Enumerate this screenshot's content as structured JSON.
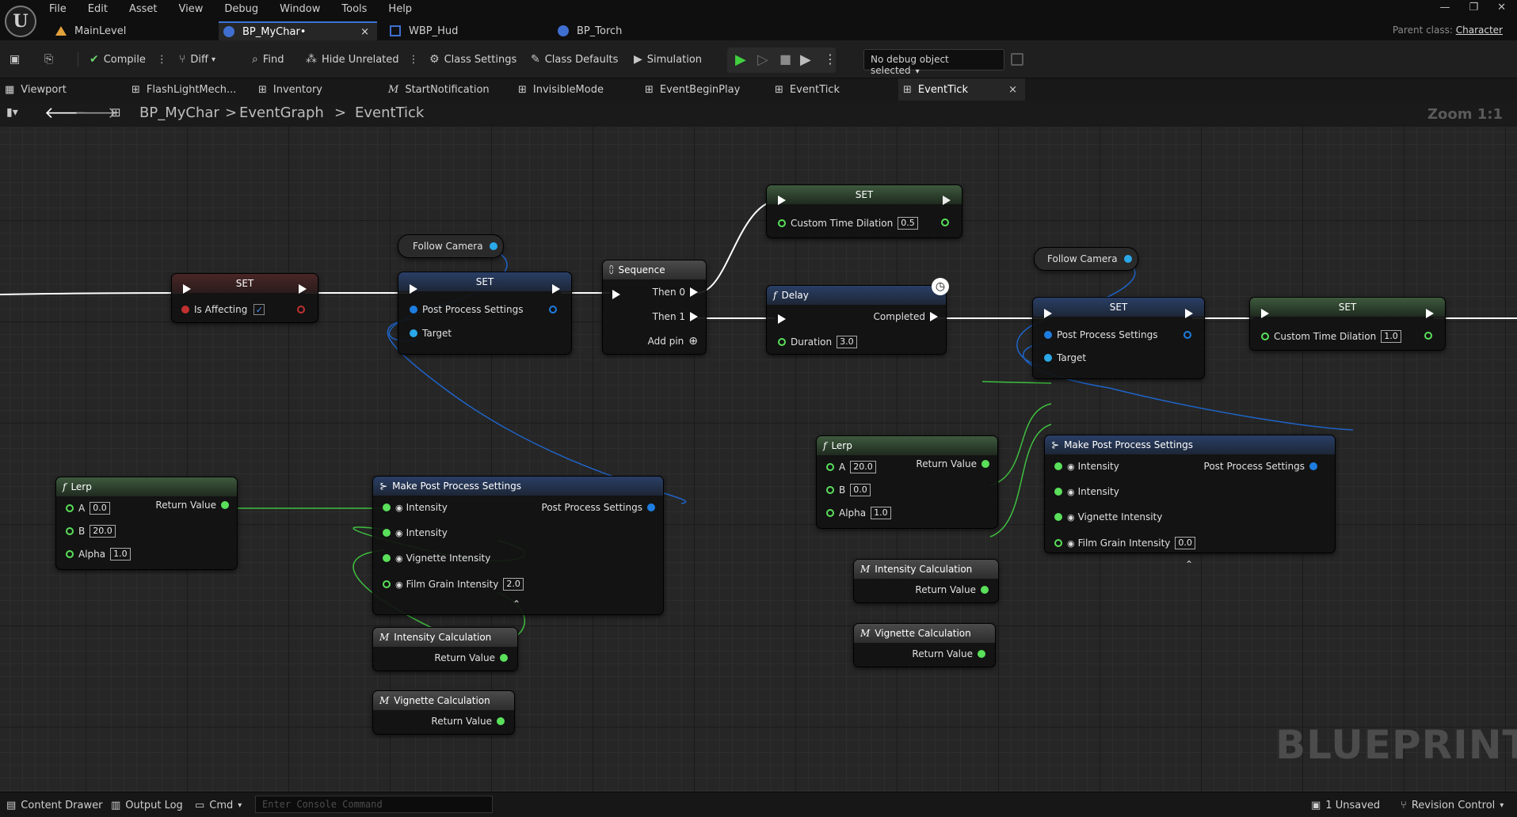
{
  "menu": [
    "File",
    "Edit",
    "Asset",
    "View",
    "Debug",
    "Window",
    "Tools",
    "Help"
  ],
  "doc_tabs": [
    {
      "label": "MainLevel"
    },
    {
      "label": "BP_MyChar•"
    },
    {
      "label": "WBP_Hud"
    },
    {
      "label": "BP_Torch"
    }
  ],
  "close_glyph": "×",
  "parent_class": {
    "label": "Parent class:",
    "value": "Character"
  },
  "toolbar": {
    "compile": "Compile",
    "diff": "Diff",
    "find": "Find",
    "hide_unrelated": "Hide Unrelated",
    "class_settings": "Class Settings",
    "class_defaults": "Class Defaults",
    "simulation": "Simulation",
    "debug_object": "No debug object selected"
  },
  "graph_tabs": [
    "Viewport",
    "FlashLightMech...",
    "Inventory",
    "StartNotification",
    "InvisibleMode",
    "EventBeginPlay",
    "EventTick",
    "EventTick"
  ],
  "breadcrumb": {
    "root": "BP_MyChar",
    "graph": "EventGraph",
    "sub": "EventTick",
    "sep": ">"
  },
  "zoom": "Zoom 1:1",
  "watermark": "BLUEPRINT",
  "nodes": {
    "set_affecting": {
      "title": "SET",
      "pin": "Is Affecting",
      "checked": "✓"
    },
    "follow_camera_1": {
      "label": "Follow Camera"
    },
    "set_pps_1": {
      "title": "SET",
      "pin1": "Post Process Settings",
      "pin2": "Target"
    },
    "sequence": {
      "title": "Sequence",
      "then0": "Then 0",
      "then1": "Then 1",
      "add_pin": "Add pin"
    },
    "set_dilation_1": {
      "title": "SET",
      "pin": "Custom Time Dilation",
      "value": "0.5"
    },
    "delay": {
      "title": "Delay",
      "out": "Completed",
      "pin": "Duration",
      "value": "3.0"
    },
    "follow_camera_2": {
      "label": "Follow Camera"
    },
    "set_pps_2": {
      "title": "SET",
      "pin1": "Post Process Settings",
      "pin2": "Target"
    },
    "set_dilation_2": {
      "title": "SET",
      "pin": "Custom Time Dilation",
      "value": "1.0"
    },
    "lerp_1": {
      "title": "Lerp",
      "a": "A",
      "a_val": "0.0",
      "b": "B",
      "b_val": "20.0",
      "alpha": "Alpha",
      "alpha_val": "1.0",
      "out": "Return Value"
    },
    "make_pps_1": {
      "title": "Make Post Process Settings",
      "in1": "Intensity",
      "in2": "Intensity",
      "in3": "Vignette Intensity",
      "in4": "Film Grain Intensity",
      "in4_val": "2.0",
      "out": "Post Process Settings"
    },
    "intensity_calc_1": {
      "title": "Intensity Calculation",
      "out": "Return Value"
    },
    "vignette_calc_1": {
      "title": "Vignette Calculation",
      "out": "Return Value"
    },
    "lerp_2": {
      "title": "Lerp",
      "a": "A",
      "a_val": "20.0",
      "b": "B",
      "b_val": "0.0",
      "alpha": "Alpha",
      "alpha_val": "1.0",
      "out": "Return Value"
    },
    "make_pps_2": {
      "title": "Make Post Process Settings",
      "in1": "Intensity",
      "in2": "Intensity",
      "in3": "Vignette Intensity",
      "in4": "Film Grain Intensity",
      "in4_val": "0.0",
      "out": "Post Process Settings"
    },
    "intensity_calc_2": {
      "title": "Intensity Calculation",
      "out": "Return Value"
    },
    "vignette_calc_2": {
      "title": "Vignette Calculation",
      "out": "Return Value"
    }
  },
  "statusbar": {
    "content_drawer": "Content Drawer",
    "output_log": "Output Log",
    "cmd": "Cmd",
    "console_placeholder": "Enter Console Command",
    "unsaved": "1 Unsaved",
    "revision_control": "Revision Control"
  },
  "colors": {
    "accent": "#3b74d3",
    "exec": "#ffffff",
    "float_pin": "#5ae05a",
    "struct_pin": "#1e7de0",
    "bool_pin": "#c03030"
  }
}
